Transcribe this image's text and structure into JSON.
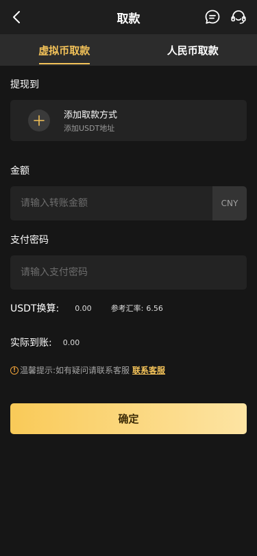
{
  "header": {
    "title": "取款"
  },
  "tabs": [
    {
      "label": "虚拟币取款",
      "active": true
    },
    {
      "label": "人民币取款",
      "active": false
    }
  ],
  "withdraw_to": {
    "section_title": "提现到",
    "add_method_title": "添加取款方式",
    "add_method_subtitle": "添加USDT地址"
  },
  "amount": {
    "section_title": "金额",
    "placeholder": "请输入转账金额",
    "value": "",
    "unit": "CNY"
  },
  "password": {
    "section_title": "支付密码",
    "placeholder": "请输入支付密码",
    "value": ""
  },
  "conversion": {
    "usdt_label": "USDT换算:",
    "usdt_value": "0.00",
    "rate_label": "参考汇率:",
    "rate_value": "6.56",
    "actual_label": "实际到账:",
    "actual_value": "0.00"
  },
  "tip": {
    "text": "温馨提示:如有疑问请联系客服",
    "link": "联系客服"
  },
  "confirm_label": "确定",
  "colors": {
    "accent": "#f3c259",
    "background": "#161616",
    "card": "#232323"
  },
  "icons": {
    "back": "chevron-left-icon",
    "message": "chat-bubble-icon",
    "support": "headset-icon",
    "add": "plus-icon",
    "warning": "info-circle-icon"
  }
}
